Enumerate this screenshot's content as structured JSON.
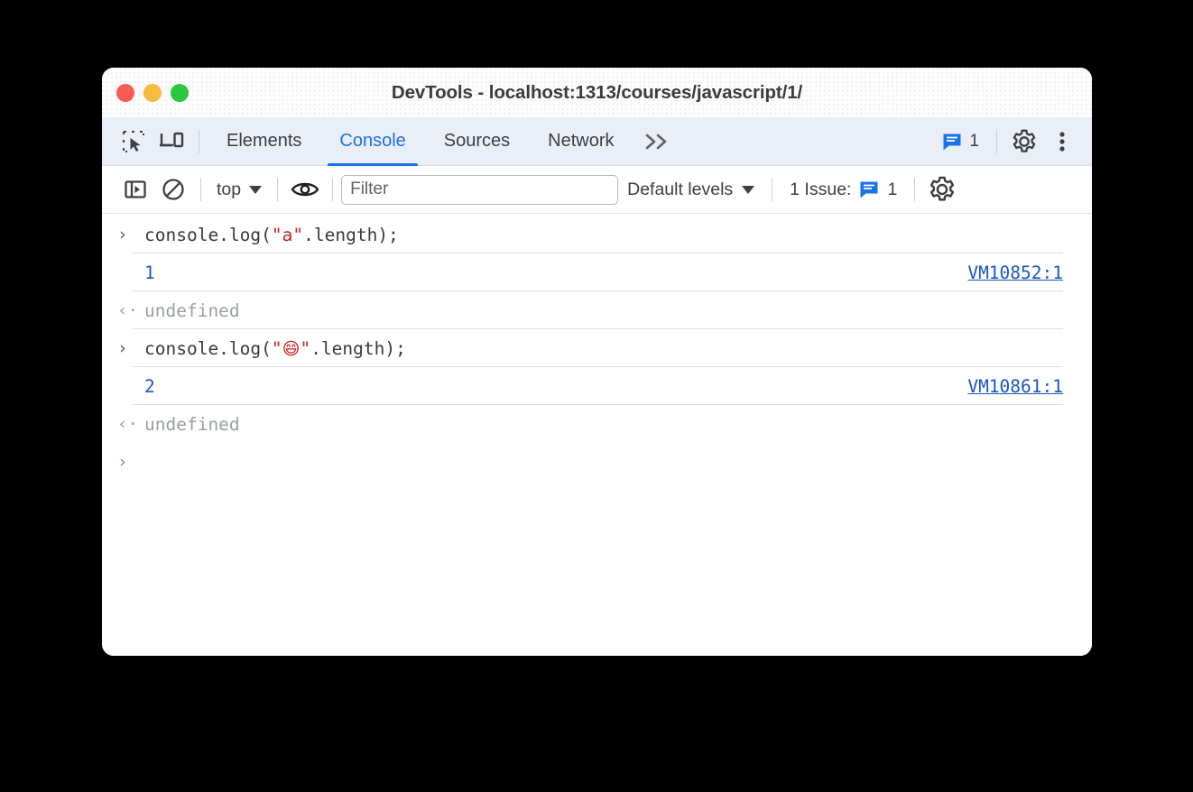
{
  "window": {
    "title": "DevTools - localhost:1313/courses/javascript/1/",
    "traffic_lights": [
      "close",
      "minimize",
      "zoom"
    ]
  },
  "tabbar": {
    "inspect_icon": "inspect-element-icon",
    "device_icon": "device-toolbar-icon",
    "tabs": [
      {
        "label": "Elements",
        "active": false
      },
      {
        "label": "Console",
        "active": true
      },
      {
        "label": "Sources",
        "active": false
      },
      {
        "label": "Network",
        "active": false
      }
    ],
    "more_tabs_label": "»",
    "issues_count": "1",
    "settings_icon": "gear-icon",
    "more_options_icon": "kebab-menu-icon"
  },
  "console_toolbar": {
    "sidebar_icon": "console-sidebar-icon",
    "clear_icon": "clear-console-icon",
    "context_label": "top",
    "eye_icon": "live-expression-eye-icon",
    "filter_value": "",
    "filter_placeholder": "Filter",
    "levels_label": "Default levels",
    "issue_label": "1 Issue:",
    "issue_count": "1",
    "settings_icon": "console-settings-gear-icon"
  },
  "console": {
    "entries": [
      {
        "kind": "input",
        "gutter": "›",
        "code_prefix": "console.log(",
        "quote": "\"",
        "string": "a",
        "code_suffix": ".length);",
        "is_emoji": false
      },
      {
        "kind": "log",
        "value": "1",
        "source": "VM10852:1"
      },
      {
        "kind": "result",
        "gutter": "‹·",
        "value": "undefined"
      },
      {
        "kind": "input",
        "gutter": "›",
        "code_prefix": "console.log(",
        "quote": "\"",
        "string": "😄",
        "code_suffix": ".length);",
        "is_emoji": true
      },
      {
        "kind": "log",
        "value": "2",
        "source": "VM10861:1"
      },
      {
        "kind": "result",
        "gutter": "‹·",
        "value": "undefined"
      }
    ],
    "prompt_chevron": "›",
    "prompt_value": ""
  },
  "colors": {
    "accent_blue": "#1a73e8",
    "link_blue": "#1a56c4",
    "string_red": "#c5221f",
    "muted_gray": "#9aa0a6",
    "tabbar_bg": "#eaeef7",
    "desktop_bg": "#000000"
  }
}
